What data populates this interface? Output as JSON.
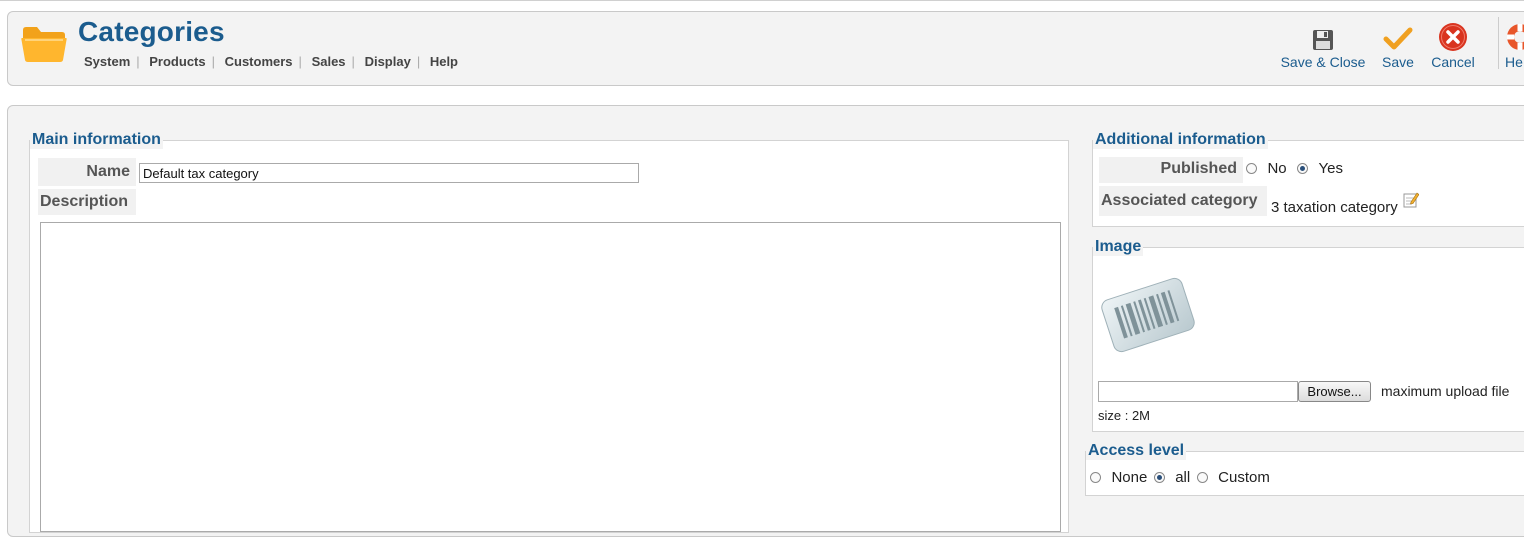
{
  "header": {
    "title": "Categories",
    "menu": [
      "System",
      "Products",
      "Customers",
      "Sales",
      "Display",
      "Help"
    ]
  },
  "toolbar": {
    "save_close": "Save & Close",
    "save": "Save",
    "cancel": "Cancel",
    "help": "He"
  },
  "main": {
    "legend": "Main information",
    "name_label": "Name",
    "name_value": "Default tax category",
    "description_label": "Description",
    "description_value": ""
  },
  "additional": {
    "legend": "Additional information",
    "published_label": "Published",
    "no_label": "No",
    "yes_label": "Yes",
    "published_selected": "Yes",
    "associated_label": "Associated category",
    "associated_value": "3 taxation category"
  },
  "image": {
    "legend": "Image",
    "file_value": "",
    "browse_label": "Browse...",
    "max_text": "maximum upload file",
    "size_text": "size : 2M"
  },
  "access": {
    "legend": "Access level",
    "none_label": "None",
    "all_label": "all",
    "custom_label": "Custom",
    "selected": "all"
  },
  "colors": {
    "accent": "#1b5c8e",
    "cancel_red": "#d9341f",
    "save_check": "#f0a020"
  },
  "icons": [
    "folder-icon",
    "floppy-disk-icon",
    "checkmark-icon",
    "cancel-icon",
    "lifebuoy-icon",
    "edit-icon",
    "barcode-icon"
  ]
}
